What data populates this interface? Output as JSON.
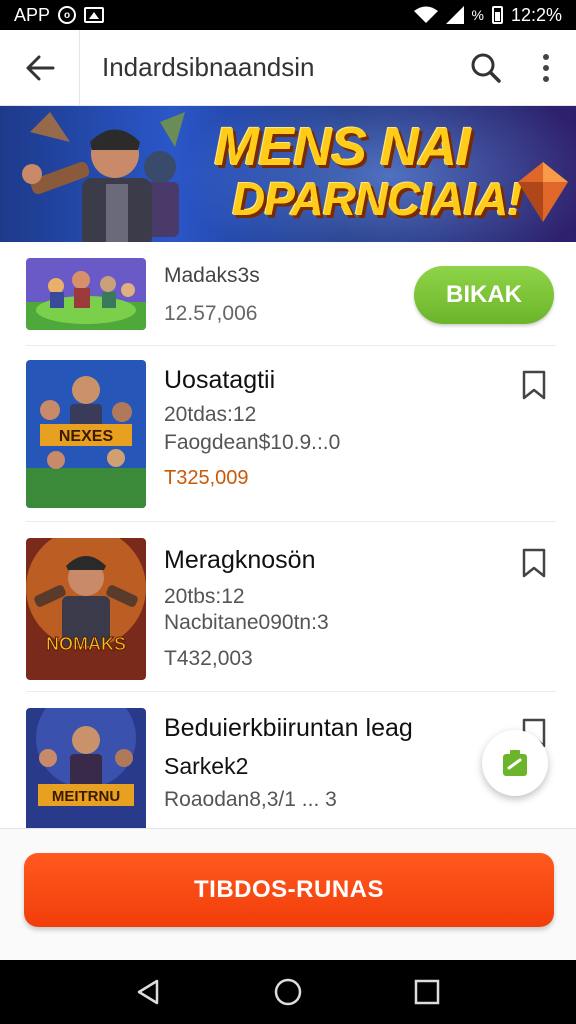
{
  "status_bar": {
    "left_text": "APP",
    "left_icons": [
      "circle-icon",
      "image-icon"
    ],
    "percent": "%",
    "time": "12:2%"
  },
  "toolbar": {
    "title": "Indardsibnaandsin",
    "icons": [
      "back-arrow-icon",
      "search-icon",
      "more-vert-icon"
    ]
  },
  "banner": {
    "line1": "MENS NAI",
    "line2": "DPARNCIAIA!"
  },
  "items": [
    {
      "name": "Madaks3s",
      "sub": "12.57,006",
      "action": "BIKAK"
    },
    {
      "name": "Uosatagtii",
      "sub1": "20tdas:12",
      "sub2": "Faogdean$10.9.:.0",
      "price": "T325,009",
      "thumb_label": "NEXES"
    },
    {
      "name": "Meragknosön",
      "sub1": "20tbs:12",
      "sub2": "Nacbitane090tn:3",
      "price": "T432,003",
      "thumb_label": "NOMAKS"
    },
    {
      "name": "Beduierkbiiruntan leag",
      "sub1": "Sarkek2",
      "sub2": "Roaodan8,3/1 ... 3",
      "thumb_label": "MEITRNU"
    }
  ],
  "cta": {
    "label": "TIBDOS-RUNAS"
  },
  "colors": {
    "accent_green": "#7ac23a",
    "cta_orange": "#f7470f",
    "price_orange": "#c8590a"
  },
  "nav_icons": [
    "back-triangle-icon",
    "home-circle-icon",
    "recents-square-icon"
  ]
}
